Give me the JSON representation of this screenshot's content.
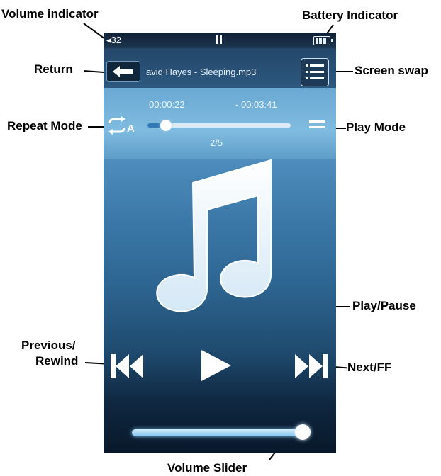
{
  "callouts": {
    "volume_indicator": "Volume indicator",
    "battery_indicator": "Battery Indicator",
    "return": "Return",
    "screen_swap": "Screen swap",
    "repeat_mode": "Repeat Mode",
    "play_mode": "Play Mode",
    "play_pause": "Play/Pause",
    "previous_rewind_line1": "Previous/",
    "previous_rewind_line2": "Rewind",
    "next_ff": "Next/FF",
    "volume_slider": "Volume Slider"
  },
  "player": {
    "status": {
      "volume_level": "32",
      "volume_icon": "speaker-icon",
      "state_icon": "pause-icon",
      "battery_icon": "battery-icon",
      "battery_fraction": 1.0
    },
    "title": {
      "return_icon": "back-arrow-icon",
      "song": "avid Hayes - Sleeping.mp3",
      "screen_swap_icon": "list-icon"
    },
    "progress": {
      "elapsed": "00:00:22",
      "remaining": "- 00:03:41",
      "position_fraction": 0.1,
      "track_counter": "2/5",
      "repeat_icon": "repeat-a-icon",
      "play_mode_icon": "sequential-icon"
    },
    "album_art_icon": "music-note-icon",
    "controls": {
      "previous_icon": "previous-icon",
      "play_icon": "play-icon",
      "next_icon": "next-icon"
    },
    "volume_fraction": 0.97
  },
  "colors": {
    "screen_top": "#16283c",
    "screen_mid": "#5e9ec9",
    "screen_bottom": "#08182a",
    "accent": "#7fc4ef"
  }
}
